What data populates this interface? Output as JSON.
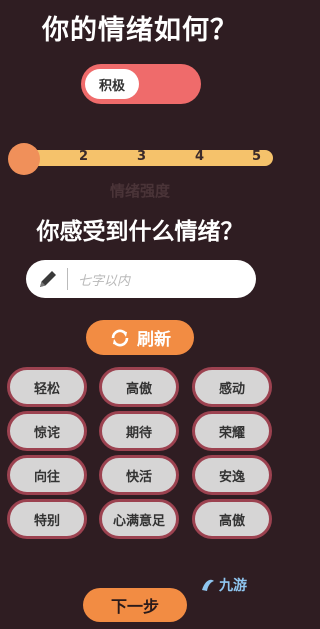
{
  "header": {
    "title": "你的情绪如何？"
  },
  "mood_toggle": {
    "label": "积极"
  },
  "intensity_slider": {
    "ticks": [
      "2",
      "3",
      "4",
      "5"
    ],
    "value": 1,
    "label": "情绪强度"
  },
  "question": {
    "title": "你感受到什么情绪？"
  },
  "emotion_input": {
    "placeholder": "七字以内",
    "value": ""
  },
  "refresh_button": {
    "label": "刷新"
  },
  "emotion_chips": [
    "轻松",
    "高傲",
    "感动",
    "惊诧",
    "期待",
    "荣耀",
    "向往",
    "快活",
    "安逸",
    "特别",
    "心满意足",
    "高傲"
  ],
  "next_button": {
    "label": "下一步"
  },
  "watermark": {
    "text": "九游"
  },
  "colors": {
    "background": "#2f1d22",
    "toggle": "#ef6b6b",
    "slider_track": "#f5c26b",
    "slider_knob": "#f0905a",
    "accent_button": "#f28c43",
    "chip_fill": "#d6d5d5",
    "chip_border": "#9c4250"
  }
}
